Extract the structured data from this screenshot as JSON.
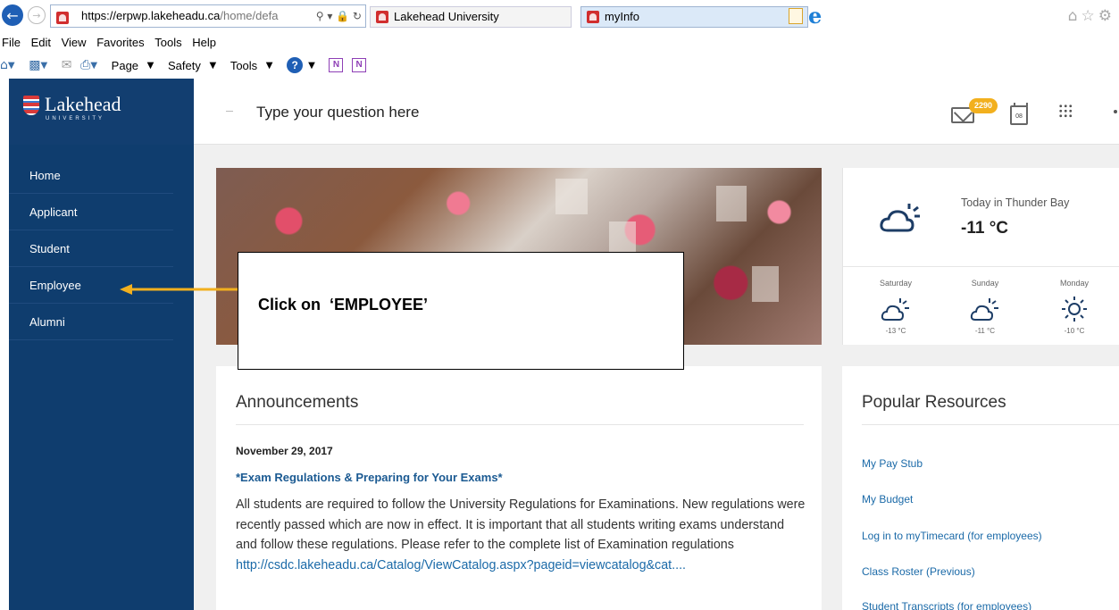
{
  "browser": {
    "url_host": "https://erpwp.lakeheadu.ca",
    "url_rest": "/home/defa",
    "tabs": [
      {
        "label": "Lakehead University"
      },
      {
        "label": "myInfo"
      }
    ],
    "tab_close_glyph": "×",
    "menu": [
      "File",
      "Edit",
      "View",
      "Favorites",
      "Tools",
      "Help"
    ],
    "commands": [
      "Page",
      "Safety",
      "Tools"
    ]
  },
  "sidebar": {
    "brand_name": "Lakehead",
    "brand_sub": "UNIVERSITY",
    "items": [
      {
        "label": "Home"
      },
      {
        "label": "Applicant"
      },
      {
        "label": "Student"
      },
      {
        "label": "Employee"
      },
      {
        "label": "Alumni"
      }
    ]
  },
  "header": {
    "search_placeholder": "Type your question here",
    "mail_badge": "2290",
    "calendar_day": "08"
  },
  "weather": {
    "title": "Today in Thunder Bay",
    "temp": "-11 °C",
    "forecast": [
      {
        "day": "Saturday",
        "temp": "-13 °C",
        "icon": "partly-cloudy-icon"
      },
      {
        "day": "Sunday",
        "temp": "-11 °C",
        "icon": "partly-cloudy-icon"
      },
      {
        "day": "Monday",
        "temp": "-10 °C",
        "icon": "sun-icon"
      }
    ]
  },
  "announcements": {
    "title": "Announcements",
    "date": "November 29, 2017",
    "headline": "*Exam Regulations & Preparing for Your Exams*",
    "body": "All students are required to follow the University Regulations for Examinations. New regulations were recently passed which are now in effect. It is important that all students writing exams understand and follow these regulations. Please refer to the complete list of Examination regulations ",
    "link": "http://csdc.lakeheadu.ca/Catalog/ViewCatalog.aspx?pageid=viewcatalog&cat...."
  },
  "resources": {
    "title": "Popular Resources",
    "items": [
      {
        "label": "My Pay Stub"
      },
      {
        "label": "My Budget"
      },
      {
        "label": "Log in to myTimecard (for employees)"
      },
      {
        "label": "Class Roster (Previous)"
      },
      {
        "label": "Student Transcripts (for employees)"
      }
    ]
  },
  "annotation": {
    "text": "Click on  ‘EMPLOYEE’",
    "arrow_color": "#f2b01e"
  }
}
